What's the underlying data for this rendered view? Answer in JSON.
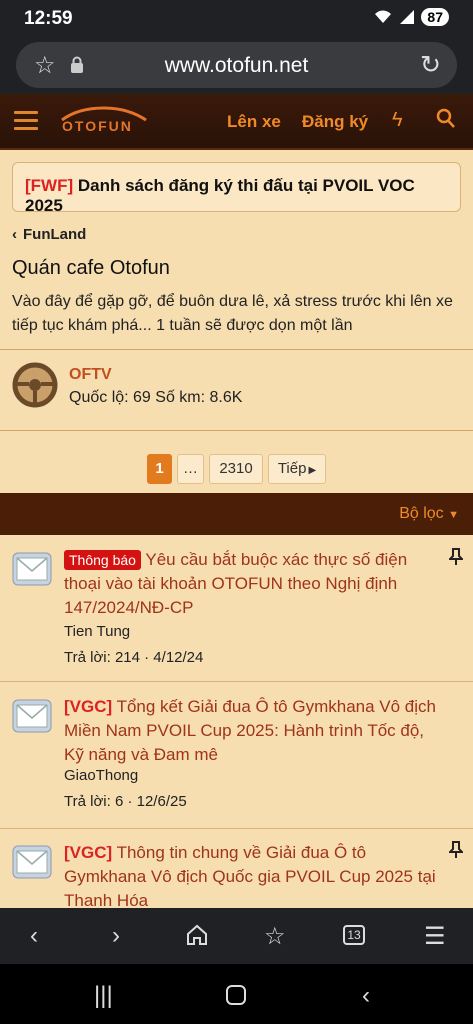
{
  "status": {
    "time": "12:59",
    "battery": "87"
  },
  "browser": {
    "url": "www.otofun.net",
    "tabs_count": "13"
  },
  "header": {
    "logo_text": "OTOFUN",
    "nav_login": "Lên xe",
    "nav_register": "Đăng ký"
  },
  "notice": {
    "tag": "[FWF]",
    "text": " Danh sách đăng ký thi đấu tại PVOIL VOC 2025"
  },
  "breadcrumb": {
    "label": "FunLand"
  },
  "forum": {
    "title": "Quán cafe Otofun",
    "description": "Vào đây để gặp gỡ, để buôn dưa lê, xả stress trước khi lên xe tiếp tục khám phá... 1 tuần sẽ được dọn một lần"
  },
  "moderator": {
    "name": "OFTV",
    "stats": "Quốc lộ: 69 Số km: 8.6K"
  },
  "pagination": {
    "current": "1",
    "ellipsis": "…",
    "last": "2310",
    "next": "Tiếp"
  },
  "filter": {
    "label": "Bộ lọc"
  },
  "threads": [
    {
      "badge": "Thông báo",
      "prefix": "",
      "title": " Yêu cầu bắt buộc xác thực số điện thoại vào tài khoản OTOFUN theo Nghị định 147/2024/NĐ-CP",
      "author": "Tien Tung",
      "meta": "Trả lời: 214 · 4/12/24",
      "pinned": true
    },
    {
      "badge": "",
      "prefix": "[VGC]",
      "title": " Tổng kết Giải đua Ô tô Gymkhana Vô địch Miền Nam PVOIL Cup 2025: Hành trình Tốc độ, Kỹ năng và Đam mê",
      "author": "GiaoThong",
      "meta": "Trả lời: 6 · 12/6/25",
      "pinned": false
    },
    {
      "badge": "",
      "prefix": "[VGC]",
      "title": " Thông tin chung về Giải đua Ô tô Gymkhana Vô địch Quốc gia PVOIL Cup 2025 tại Thanh Hóa",
      "author": "",
      "meta": "",
      "pinned": true
    }
  ],
  "colors": {
    "accent": "#e27b1e",
    "background": "#f6deb1",
    "header": "#3a1a0a",
    "link": "#a0341a",
    "badge": "#d51212"
  }
}
